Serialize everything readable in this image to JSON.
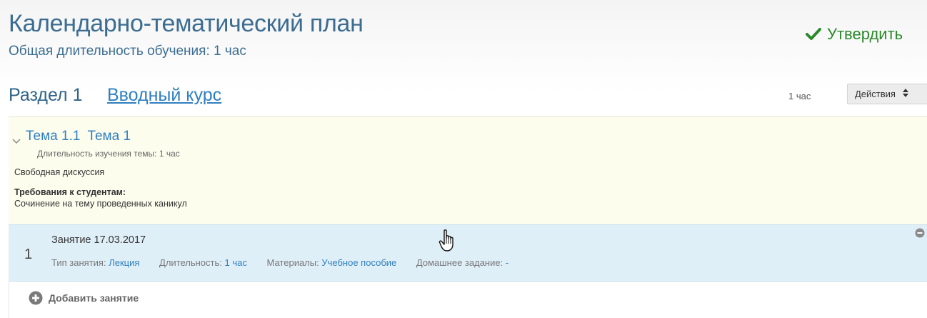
{
  "header": {
    "title": "Календарно-тематический план",
    "subtitle": "Общая длительность обучения: 1 час",
    "approve_label": "Утвердить"
  },
  "section": {
    "label": "Раздел 1",
    "name": "Вводный курс",
    "hours": "1 час",
    "actions_label": "Действия"
  },
  "theme": {
    "number": "Тема 1.1",
    "name": "Тема 1",
    "duration": "Длительность изучения темы: 1 час",
    "format": "Свободная дискуссия",
    "requirements_label": "Требования к студентам:",
    "requirements_text": "Сочинение на тему проведенных каникул"
  },
  "lesson": {
    "number": "1",
    "title": "Занятие 17.03.2017",
    "type_label": "Тип занятия:",
    "type_value": "Лекция",
    "duration_label": "Длительность:",
    "duration_value": "1 час",
    "materials_label": "Материалы:",
    "materials_value": "Учебное пособие",
    "homework_label": "Домашнее задание:",
    "homework_value": "-"
  },
  "add_lesson_label": "Добавить занятие",
  "colors": {
    "title": "#3c6d91",
    "link": "#2f7fc0",
    "approve": "#2a8a2a",
    "theme_bg": "#fdfdee",
    "lesson_bg": "#dfeff8"
  },
  "icons": [
    "check-icon",
    "chevron-down-icon",
    "sort-arrows-icon",
    "minus-circle-icon",
    "plus-circle-icon",
    "hand-cursor-icon"
  ]
}
